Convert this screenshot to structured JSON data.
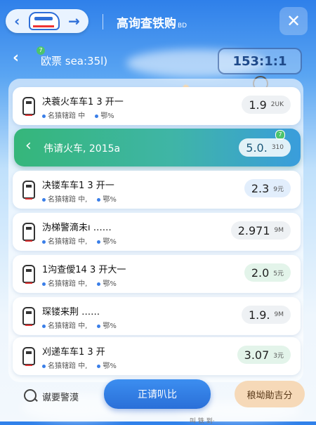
{
  "header": {
    "title": "高询查铁购",
    "title_suffix": "BD",
    "close_icon": "close-icon"
  },
  "route": {
    "badge": "7",
    "text": "欧票 sea:35l)",
    "counter": "153:1:1"
  },
  "selected": {
    "name": "伟请火车, 2015a",
    "price": "5.0.",
    "price_unit": "310",
    "badge": "7"
  },
  "rows": [
    {
      "name": "决蓑火车车1 3 开一",
      "meta1": "名猿辖踣 中",
      "meta2": "鄂%",
      "price": "1.9",
      "unit": "2UK",
      "style": "gray"
    },
    {
      "name": "决镂车车1 3 开一",
      "meta1": "名猿辖踣 中,",
      "meta2": "鄂%",
      "price": "2.3",
      "unit": "9元",
      "style": "blue"
    },
    {
      "name": "沩梯警滴未ı ……",
      "meta1": "名猿辖踣 中,",
      "meta2": "鄂%",
      "price": "2.971",
      "unit": "9M",
      "style": "gray"
    },
    {
      "name": "1沟查僾14 3 开大一",
      "meta1": "名猿辖踣 中,",
      "meta2": "鄂%",
      "price": "2.0",
      "unit": "5元",
      "style": "green"
    },
    {
      "name": "琛镂来荆 ……",
      "meta1": "名猿辖踣 中,",
      "meta2": "鄂%",
      "price": "1.9.",
      "unit": "9M",
      "style": "gray"
    },
    {
      "name": "刈递车车1 3 开",
      "meta1": "名猿辖踣 中,",
      "meta2": "鄂%",
      "price": "3.07",
      "unit": "3元",
      "style": "green"
    }
  ],
  "bottom": {
    "search_label": "谳要警漠",
    "primary": "正请叭比",
    "secondary": "稂坳勛吉分",
    "footer": "叫 铁 到·"
  }
}
